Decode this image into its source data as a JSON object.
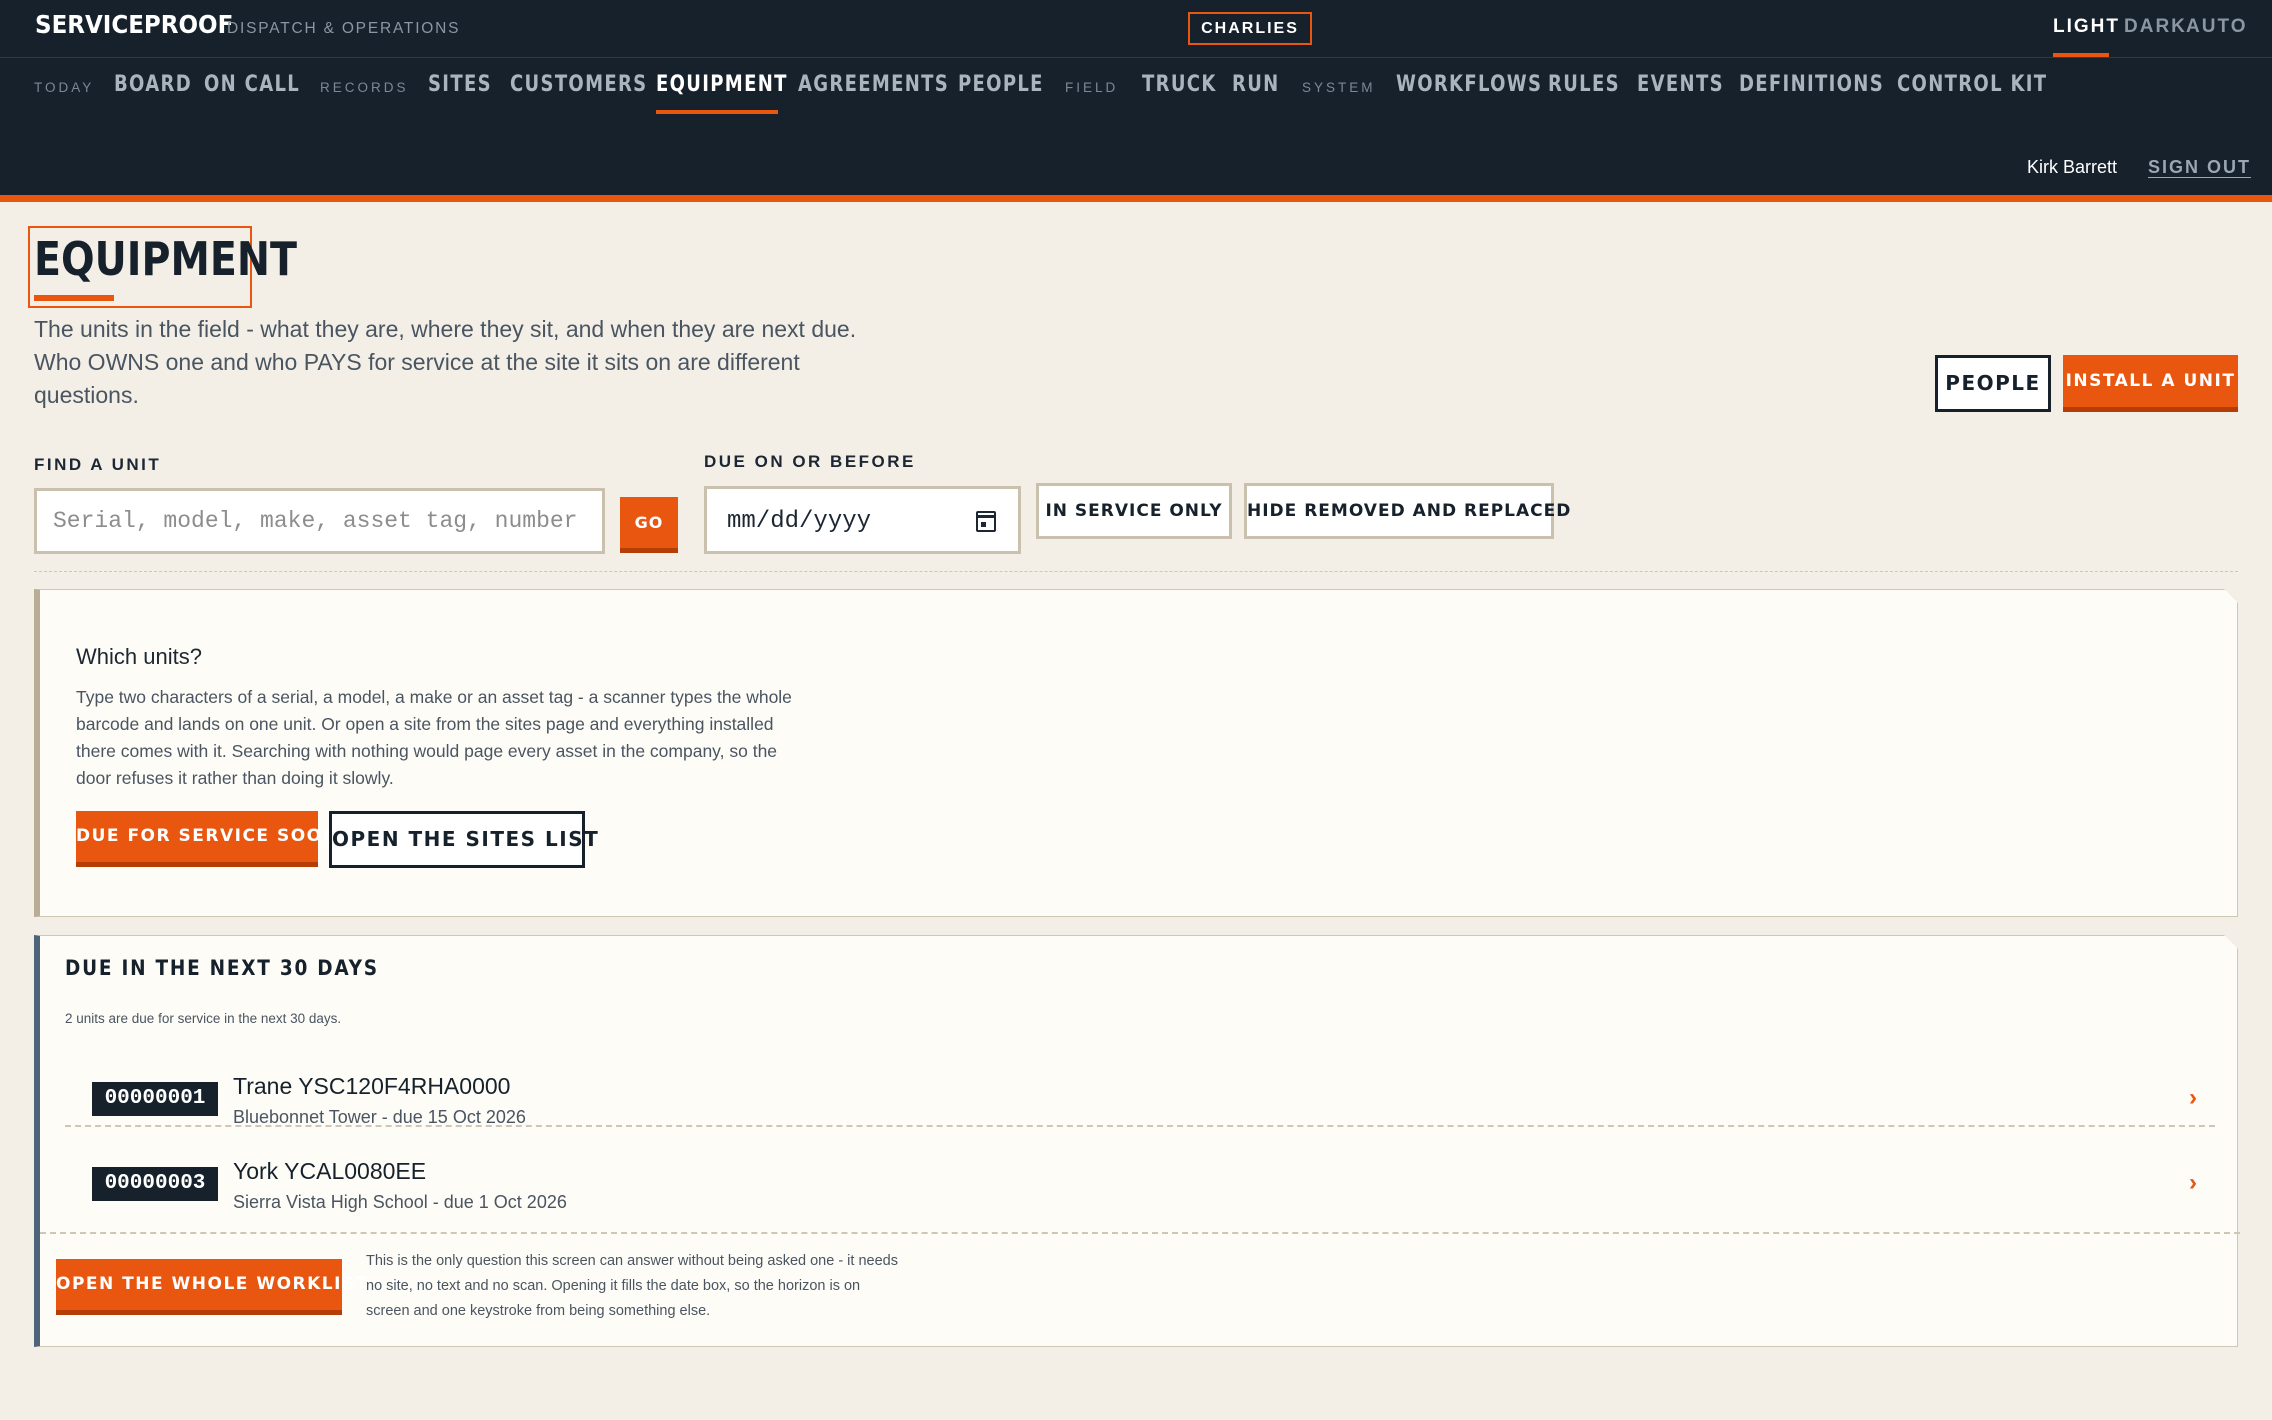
{
  "header": {
    "brand": "SERVICEPROOF",
    "brand_sub": "DISPATCH & OPERATIONS",
    "tenant": "CHARLIES",
    "theme": [
      "LIGHT",
      "DARK",
      "AUTO"
    ],
    "nav_groups": {
      "today": "TODAY",
      "records": "RECORDS",
      "field": "FIELD",
      "system": "SYSTEM"
    },
    "nav": {
      "board": "BOARD",
      "on_call": "ON CALL",
      "sites": "SITES",
      "customers": "CUSTOMERS",
      "equipment": "EQUIPMENT",
      "agreements": "AGREEMENTS",
      "people": "PEOPLE",
      "truck": "TRUCK",
      "run": "RUN",
      "workflows": "WORKFLOWS",
      "rules": "RULES",
      "events": "EVENTS",
      "definitions": "DEFINITIONS",
      "control_kit": "CONTROL KIT"
    },
    "active_nav": "EQUIPMENT",
    "user": "Kirk Barrett",
    "sign_out": "SIGN OUT"
  },
  "page": {
    "title": "EQUIPMENT",
    "description": "The units in the field - what they are, where they sit, and when they are next due. Who OWNS one and who PAYS for service at the site it sits on are different questions.",
    "people_button": "PEOPLE",
    "install_button": "INSTALL A UNIT"
  },
  "filters": {
    "find_label": "FIND A UNIT",
    "find_placeholder": "Serial, model, make, asset tag, number",
    "go_button": "GO",
    "due_label": "DUE ON OR BEFORE",
    "due_placeholder": "mm/dd/yyyy",
    "in_service_only": "IN SERVICE ONLY",
    "hide_removed": "HIDE REMOVED AND REPLACED"
  },
  "which_panel": {
    "title": "Which units?",
    "text": "Type two characters of a serial, a model, a make or an asset tag - a scanner types the whole barcode and lands on one unit. Or open a site from the sites page and everything installed there comes with it. Searching with nothing would page every asset in the company, so the door refuses it rather than doing it slowly.",
    "due_soon_button": "DUE FOR SERVICE SOON",
    "sites_list_button": "OPEN THE SITES LIST"
  },
  "due_panel": {
    "title": "DUE IN THE NEXT 30 DAYS",
    "count_text": "2 units are due for service in the next 30 days.",
    "units": [
      {
        "tag": "00000001",
        "name": "Trane YSC120F4RHA0000",
        "meta": "Bluebonnet Tower - due 15 Oct 2026"
      },
      {
        "tag": "00000003",
        "name": "York YCAL0080EE",
        "meta": "Sierra Vista High School - due 1 Oct 2026"
      }
    ],
    "worklist_button": "OPEN THE WHOLE WORKLIST",
    "worklist_note": "This is the only question this screen can answer without being asked one - it needs no site, no text and no scan. Opening it fills the date box, so the horizon is on screen and one keystroke from being something else."
  },
  "colors": {
    "accent": "#e8560f",
    "header_bg": "#16212c",
    "page_bg": "#f3efe7"
  },
  "icons": [
    "calendar-icon",
    "chevron-right-icon"
  ]
}
